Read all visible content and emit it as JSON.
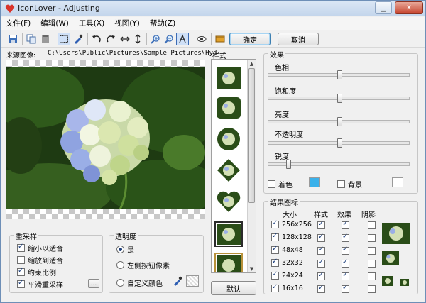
{
  "window": {
    "title": "IconLover - Adjusting",
    "close_glyph": "✕",
    "minimize_glyph": "▁"
  },
  "menu": [
    {
      "label": "文件(F)"
    },
    {
      "label": "编辑(W)"
    },
    {
      "label": "工具(X)"
    },
    {
      "label": "视图(Y)"
    },
    {
      "label": "帮助(Z)"
    }
  ],
  "toolbar": {
    "ok_label": "确定",
    "cancel_label": "取消",
    "icons": [
      "save-icon",
      "copy-icon",
      "paste-icon",
      "select-icon",
      "eyedropper-icon",
      "rotate-left-icon",
      "rotate-right-icon",
      "flip-horizontal-icon",
      "flip-vertical-icon",
      "zoom-in-icon",
      "zoom-out-icon",
      "text-icon",
      "view-icon",
      "book-icon"
    ]
  },
  "source": {
    "label": "来源图像:",
    "path": "C:\\Users\\Public\\Pictures\\Sample Pictures\\Hyd"
  },
  "resample": {
    "title": "重采样",
    "options": [
      {
        "label": "缩小以适合",
        "checked": true
      },
      {
        "label": "缩放到适合",
        "checked": false
      },
      {
        "label": "约束比例",
        "checked": true
      },
      {
        "label": "平滑重采样",
        "checked": true
      }
    ],
    "more_label": "..."
  },
  "transparency": {
    "title": "透明度",
    "options": [
      {
        "label": "是",
        "selected": true
      },
      {
        "label": "左侧按钮像素",
        "selected": false
      },
      {
        "label": "自定义颜色",
        "selected": false
      }
    ]
  },
  "styles": {
    "label": "样式",
    "items": [
      "square",
      "rounded",
      "circle",
      "diamond",
      "heart",
      "framed",
      "framed-gold"
    ],
    "selected": "framed",
    "default_label": "默认"
  },
  "effects": {
    "title": "效果",
    "sliders": [
      {
        "label": "色相",
        "value": 0.5
      },
      {
        "label": "饱和度",
        "value": 0.5
      },
      {
        "label": "亮度",
        "value": 0.5
      },
      {
        "label": "不透明度",
        "value": 0.5
      },
      {
        "label": "锐度",
        "value": 0.13
      }
    ],
    "colorize_label": "着色",
    "colorize_checked": false,
    "colorize_color": "#3ab1ea",
    "background_label": "背景",
    "background_checked": false,
    "background_color": "#ffffff"
  },
  "result": {
    "title": "结果图标",
    "headers": {
      "size": "大小",
      "style": "样式",
      "effect": "效果",
      "shadow": "阴影"
    },
    "rows": [
      {
        "size": "256x256",
        "enabled": true,
        "style": true,
        "effect": true,
        "shadow": false
      },
      {
        "size": "128x128",
        "enabled": true,
        "style": true,
        "effect": true,
        "shadow": false
      },
      {
        "size": "48x48",
        "enabled": true,
        "style": true,
        "effect": true,
        "shadow": false
      },
      {
        "size": "32x32",
        "enabled": true,
        "style": true,
        "effect": true,
        "shadow": false
      },
      {
        "size": "24x24",
        "enabled": true,
        "style": true,
        "effect": true,
        "shadow": false
      },
      {
        "size": "16x16",
        "enabled": true,
        "style": true,
        "effect": true,
        "shadow": false
      }
    ]
  },
  "colors": {
    "accent": "#3c7fb1",
    "leaf_dark": "#1e3a12",
    "flower_blue": "#8fa3e0"
  }
}
